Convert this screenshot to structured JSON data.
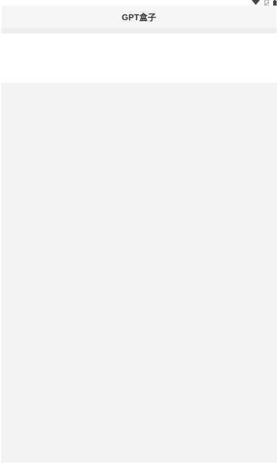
{
  "status_bar": {
    "icons": [
      "wifi-icon",
      "sim-icon",
      "battery-icon"
    ]
  },
  "header": {
    "title": "GPT盒子"
  },
  "colors": {
    "nav_background": "#f5f5f5",
    "page_background": "#f2f3f5",
    "card_background": "#ffffff",
    "title_color": "#333333"
  }
}
